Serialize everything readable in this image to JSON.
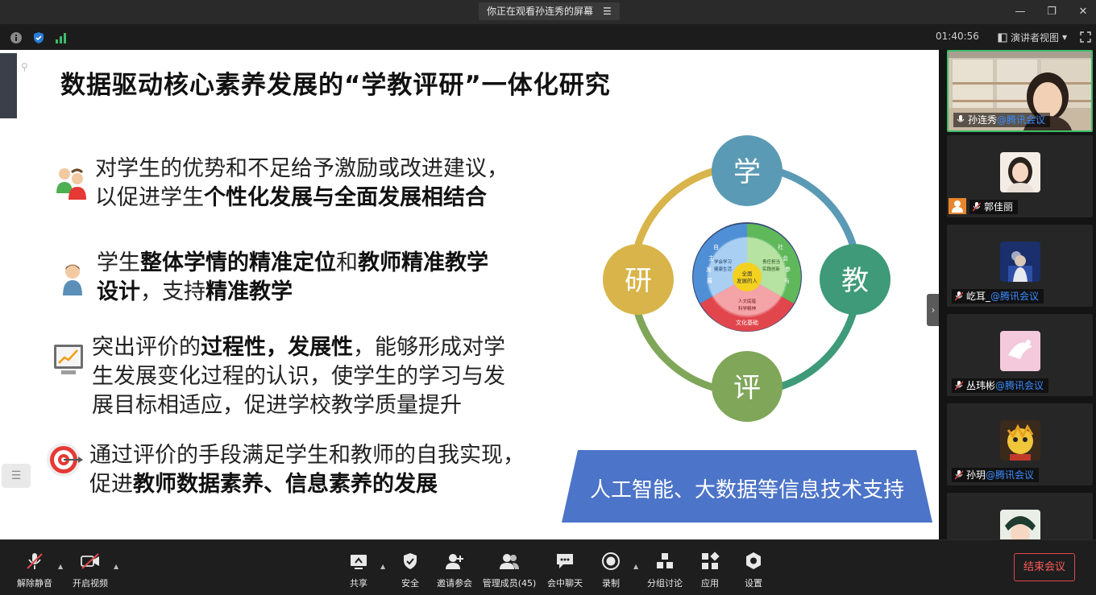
{
  "titlebar": {
    "share_status": "你正在观看孙连秀的屏幕"
  },
  "infobar": {
    "timer": "01:40:56",
    "view_mode": "演讲者视图"
  },
  "slide": {
    "title": "数据驱动核心素养发展的“学教评研”一体化研究",
    "bullets": [
      {
        "line1_a": "对学生的优势和不足给予激励或改进建议，",
        "line2_a": "以促进学生",
        "line2_b": "个性化发展与全面发展相结合"
      },
      {
        "line1_a": "学生",
        "line1_b": "整体学情的精准定位",
        "line1_c": "和",
        "line1_d": "教师精准教学",
        "line2_a": "设计",
        "line2_b": "，支持",
        "line2_c": "精准教学"
      },
      {
        "line1_a": "突出评价的",
        "line1_b": "过程性，发展性",
        "line1_c": "，能够形成对学",
        "line2": "生发展变化过程的认识，使学生的学习与发",
        "line3": "展目标相适应，促进学校教学质量提升"
      },
      {
        "line1": "通过评价的手段满足学生和教师的自我实现，",
        "line2_a": "促进",
        "line2_b": "教师数据素养、信息素养的发展"
      }
    ],
    "diagram": {
      "nodes": [
        "学",
        "教",
        "评",
        "研"
      ],
      "core_center": "全面\n发展的人",
      "core_top_left": [
        "学会学习",
        "健康生活"
      ],
      "core_top_right": [
        "责任担当",
        "实践创新"
      ],
      "core_bottom": [
        "人文底蕴",
        "科学精神"
      ],
      "ring_left": "自主发展",
      "ring_right": "社会参与",
      "ring_bottom": "文化基础",
      "colors": {
        "xue": "#5b9ab4",
        "jiao": "#3e9a78",
        "ping": "#7fa659",
        "yan": "#d8b44a"
      }
    },
    "banner": "人工智能、大数据等信息技术支持"
  },
  "participants": [
    {
      "name": "孙连秀",
      "org": "@腾讯会议",
      "active": true
    },
    {
      "name": "郭佳丽",
      "org": ""
    },
    {
      "name": "屹耳_",
      "org": "@腾讯会议"
    },
    {
      "name": "丛玮彬",
      "org": "@腾讯会议"
    },
    {
      "name": "孙玥",
      "org": "@腾讯会议"
    },
    {
      "name": "",
      "org": ""
    }
  ],
  "toolbar": {
    "unmute": "解除静音",
    "start_video": "开启视频",
    "share": "共享",
    "security": "安全",
    "invite": "邀请参会",
    "manage_members": "管理成员(45)",
    "chat": "会中聊天",
    "record": "录制",
    "breakout": "分组讨论",
    "apps": "应用",
    "settings": "设置",
    "end_meeting": "结束会议"
  }
}
